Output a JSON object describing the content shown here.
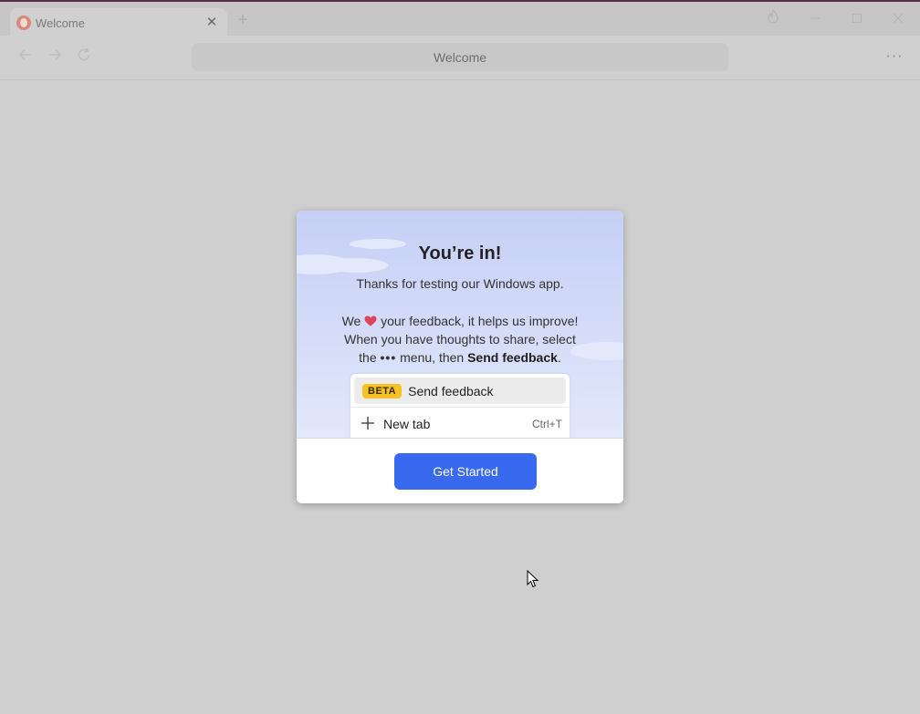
{
  "tab": {
    "title": "Welcome",
    "close": "✕"
  },
  "toolbar": {
    "address": "Welcome",
    "new_tab": "+",
    "menu": "···"
  },
  "dialog": {
    "title": "You’re in!",
    "subtitle": "Thanks for testing our Windows app.",
    "line1_pre": "We",
    "line1_post": "your feedback, it helps us improve!",
    "line2": "When you have thoughts to share, select",
    "line3_pre": "the",
    "line3_mid": "menu, then",
    "line3_bold": "Send feedback",
    "line3_end": ".",
    "menu_preview": {
      "badge": "BETA",
      "feedback_label": "Send feedback",
      "newtab_label": "New tab",
      "newtab_shortcut": "Ctrl+T"
    },
    "button": "Get Started"
  },
  "colors": {
    "accent": "#3969ef",
    "beta_badge": "#f7c223",
    "heart": "#e0445c"
  },
  "icons": [
    "duckduckgo-favicon",
    "close-icon",
    "plus-icon",
    "fire-icon",
    "minimize-icon",
    "maximize-icon",
    "back-icon",
    "forward-icon",
    "reload-icon",
    "more-menu-icon",
    "heart-icon",
    "cursor-icon"
  ]
}
